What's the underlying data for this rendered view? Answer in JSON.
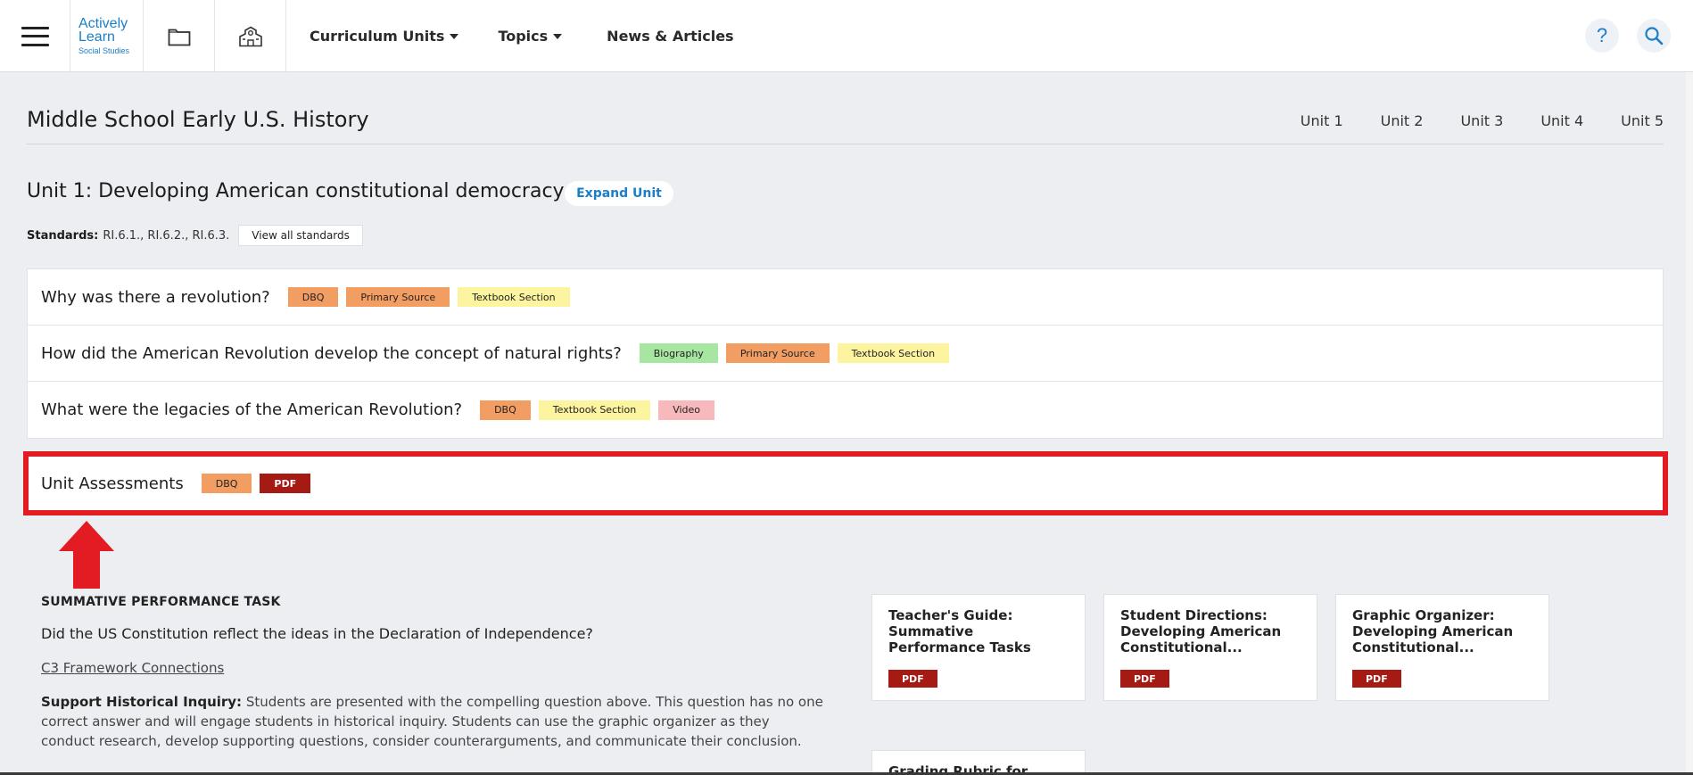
{
  "nav": {
    "logo": {
      "line1": "Actively",
      "line2": "Learn",
      "line3": "Social Studies"
    },
    "menu": [
      {
        "label": "Curriculum Units",
        "has_caret": true
      },
      {
        "label": "Topics",
        "has_caret": true
      },
      {
        "label": "News & Articles",
        "has_caret": false
      }
    ],
    "icons": [
      "menu-icon",
      "folder-icon",
      "school-icon",
      "help-icon",
      "search-icon"
    ],
    "help_glyph": "?"
  },
  "header": {
    "course_title": "Middle School Early U.S. History",
    "unit_tabs": [
      "Unit 1",
      "Unit 2",
      "Unit 3",
      "Unit 4",
      "Unit 5"
    ]
  },
  "unit": {
    "heading": "Unit 1: Developing American constitutional democracy",
    "expand_label": "Expand Unit",
    "standards_label": "Standards:",
    "standards_values": "RI.6.1., RI.6.2., RI.6.3.",
    "view_standards_label": "View all standards"
  },
  "lessons": [
    {
      "title": "Why was there a revolution?",
      "tags": [
        "DBQ",
        "Primary Source",
        "Textbook Section"
      ]
    },
    {
      "title": "How did the American Revolution develop the concept of natural rights?",
      "tags": [
        "Biography",
        "Primary Source",
        "Textbook Section"
      ]
    },
    {
      "title": "What were the legacies of the American Revolution?",
      "tags": [
        "DBQ",
        "Textbook Section",
        "Video"
      ]
    }
  ],
  "assessments": {
    "title": "Unit Assessments",
    "tags": [
      "DBQ",
      "PDF"
    ],
    "highlight_color": "#e31b23"
  },
  "detail": {
    "eyebrow": "SUMMATIVE PERFORMANCE TASK",
    "question": "Did the US Constitution reflect the ideas in the Declaration of Independence?",
    "c3_link": "C3 Framework Connections",
    "support_label": "Support Historical Inquiry:",
    "support_text": "Students are presented with the compelling question above. This question has no one correct answer and will engage students in historical inquiry. Students can use the graphic organizer as they conduct research, develop supporting questions, consider counterarguments, and communicate their conclusion."
  },
  "resources": [
    {
      "title": "Teacher's Guide: Summative Performance Tasks [PDF]",
      "tag": "PDF"
    },
    {
      "title": "Student Directions: Developing American Constitutional...",
      "tag": "PDF"
    },
    {
      "title": "Graphic Organizer: Developing American Constitutional...",
      "tag": "PDF"
    },
    {
      "title": "Grading Rubric for Social",
      "tag": ""
    }
  ],
  "colors": {
    "brand_blue": "#1a7ec8",
    "tag_orange": "#f29e63",
    "tag_yellow": "#fcf49e",
    "tag_green": "#a7e6a0",
    "tag_pink": "#f7b9bb",
    "tag_pdf": "#a51b14"
  }
}
